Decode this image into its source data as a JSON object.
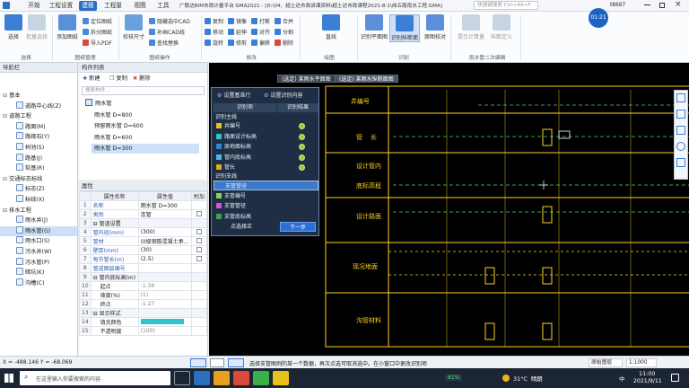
{
  "window": {
    "title": "广联达BIM市政计量平台 GMA2021 - [D:\\04、超土达市政讲课资料\\超土达市政课程2021-8-1\\纬五路雨水工程.GMA]",
    "user": "t8697",
    "timer": "01:21"
  },
  "menu_tabs": [
    "开始",
    "工程设置",
    "建模",
    "工程量",
    "视图",
    "工具"
  ],
  "search_placeholder": "快捷键搜索  Ctrl+Alt+F",
  "ribbon": {
    "select_group": {
      "big": [
        "选择",
        "批量选择"
      ],
      "label": "选择"
    },
    "drawing_group": {
      "big": [
        "添加图纸"
      ],
      "small": [
        "定位图纸",
        "拆分图纸",
        "导入PDF"
      ],
      "label": "图纸管理"
    },
    "cad_group": {
      "big": [
        "校核尺寸"
      ],
      "small": [
        "隐藏选中CAD",
        "补画CAD线",
        "查找替换"
      ],
      "label": "图纸操作"
    },
    "modify_group": {
      "small": [
        "复制",
        "移动",
        "旋转",
        "镜像",
        "延伸",
        "修剪",
        "打断",
        "对齐",
        "偏移",
        "合并",
        "分割",
        "删除"
      ],
      "label": "修改"
    },
    "draw_group": {
      "big": [
        "直线"
      ],
      "label": "绘图"
    },
    "recog_group": {
      "big": [
        "识别平面图",
        "识别纵断面",
        "原图校对"
      ],
      "label": "识别"
    },
    "edit2_group": {
      "big": [
        "提示计算量",
        "纵断定义"
      ],
      "label": "雨水管二次编辑"
    }
  },
  "nav": {
    "title": "导航栏",
    "items": [
      {
        "label": "基本",
        "type": "group"
      },
      {
        "label": "道路中心线(Z)",
        "type": "item"
      },
      {
        "label": "道路工程",
        "type": "group"
      },
      {
        "label": "路面(M)",
        "type": "item"
      },
      {
        "label": "路缘石(Y)",
        "type": "item"
      },
      {
        "label": "树池(S)",
        "type": "item"
      },
      {
        "label": "路基(J)",
        "type": "item"
      },
      {
        "label": "软基(R)",
        "type": "item"
      },
      {
        "label": "交通标志标线",
        "type": "group"
      },
      {
        "label": "标志(Z)",
        "type": "item"
      },
      {
        "label": "标线(X)",
        "type": "item"
      },
      {
        "label": "排水工程",
        "type": "group"
      },
      {
        "label": "雨水井(J)",
        "type": "item"
      },
      {
        "label": "雨水管(G)",
        "type": "item",
        "selected": true
      },
      {
        "label": "雨水口(S)",
        "type": "item"
      },
      {
        "label": "污水井(W)",
        "type": "item"
      },
      {
        "label": "污水管(P)",
        "type": "item"
      },
      {
        "label": "暗坑(K)",
        "type": "item"
      },
      {
        "label": "沟槽(C)",
        "type": "item"
      }
    ]
  },
  "component_list": {
    "title": "构件列表",
    "toolbar": [
      "新建",
      "复制",
      "删除"
    ],
    "search_placeholder": "搜索构件...",
    "items": [
      {
        "label": "雨水管",
        "level": 0
      },
      {
        "label": "雨水管 D=800",
        "level": 1
      },
      {
        "label": "预留雨水管 D=600",
        "level": 1
      },
      {
        "label": "雨水管 D=600",
        "level": 1
      },
      {
        "label": "雨水管 D=300",
        "level": 1,
        "selected": true
      }
    ]
  },
  "properties": {
    "title": "属性",
    "headers": [
      "属性名称",
      "属性值",
      "附加"
    ],
    "rows": [
      {
        "n": "1",
        "k": "名称",
        "v": "雨水管 D=300",
        "blue": true
      },
      {
        "n": "2",
        "k": "类别",
        "v": "连管",
        "blue": true,
        "cb": true
      },
      {
        "n": "3",
        "k": "⊟ 管道设置",
        "v": "",
        "grp": true
      },
      {
        "n": "4",
        "k": "管内径(mm)",
        "v": "(300)",
        "blue": true,
        "cb": true
      },
      {
        "n": "5",
        "k": "管材",
        "v": "(II级钢筋混凝土承...",
        "blue": true,
        "cb": true
      },
      {
        "n": "6",
        "k": "壁厚(mm)",
        "v": "(30)",
        "blue": true,
        "cb": true
      },
      {
        "n": "7",
        "k": "每节管长(m)",
        "v": "(2.5)",
        "blue": true,
        "cb": true
      },
      {
        "n": "8",
        "k": "管道图层编号",
        "v": "",
        "blue": true
      },
      {
        "n": "9",
        "k": "⊟ 管内底标高(m)",
        "v": "",
        "grp": true
      },
      {
        "n": "10",
        "k": "起点",
        "v": "-1.34"
      },
      {
        "n": "11",
        "k": "坡度(%)",
        "v": "(1)"
      },
      {
        "n": "12",
        "k": "终点",
        "v": "-1.27"
      },
      {
        "n": "13",
        "k": "⊟ 显示样式",
        "v": "",
        "grp": true
      },
      {
        "n": "14",
        "k": "填充颜色",
        "v": "",
        "fill": "#2ec4c9"
      },
      {
        "n": "15",
        "k": "不透明度",
        "v": "(100)"
      }
    ]
  },
  "cad": {
    "tabs": [
      "(选定) 某雨水平面图",
      "(选定) 某雨水纵断面图"
    ],
    "annotations": [
      "井编号",
      "管    长",
      "设计管内",
      "底标高程",
      "设计路面",
      "现况地面",
      "沟管材料"
    ],
    "dialog": {
      "tabs": [
        "设置基准行",
        "设置识别内容"
      ],
      "headers": [
        "识别项",
        "识别结果"
      ],
      "main_section": "识别主线",
      "main_items": [
        {
          "label": "井编号",
          "color": "#e8c21a"
        },
        {
          "label": "路面设计标高",
          "color": "#2ec4c9"
        },
        {
          "label": "原地面标高",
          "color": "#2a8ad8"
        },
        {
          "label": "管内底标高",
          "color": "#4fb6e0"
        },
        {
          "label": "管长",
          "color": "#d8b01a"
        }
      ],
      "branch_section": "识别支线",
      "branch_items": [
        {
          "label": "支管管径",
          "color": "#3a7bd5",
          "selected": true
        },
        {
          "label": "支管编号",
          "color": "#8bd44a"
        },
        {
          "label": "支管管径",
          "color": "#d455d0"
        },
        {
          "label": "支管底标高",
          "color": "#3aa84a"
        }
      ],
      "btn_prev": "点选择正",
      "btn_next": "下一步"
    }
  },
  "status": {
    "coords": "X = -488.146 Y = -68.069",
    "hint": "选择支管图例的某一个数据，再次点选可取消选中。在小窗口中更改识别项",
    "layer": "原始图层",
    "scale": "1:1000"
  },
  "taskbar": {
    "search_placeholder": "在这里输入你要搜索的内容",
    "battery": "81%",
    "weather": "31°C  晴朗",
    "ime": "中",
    "time": "11:00",
    "date": "2021/9/11"
  }
}
